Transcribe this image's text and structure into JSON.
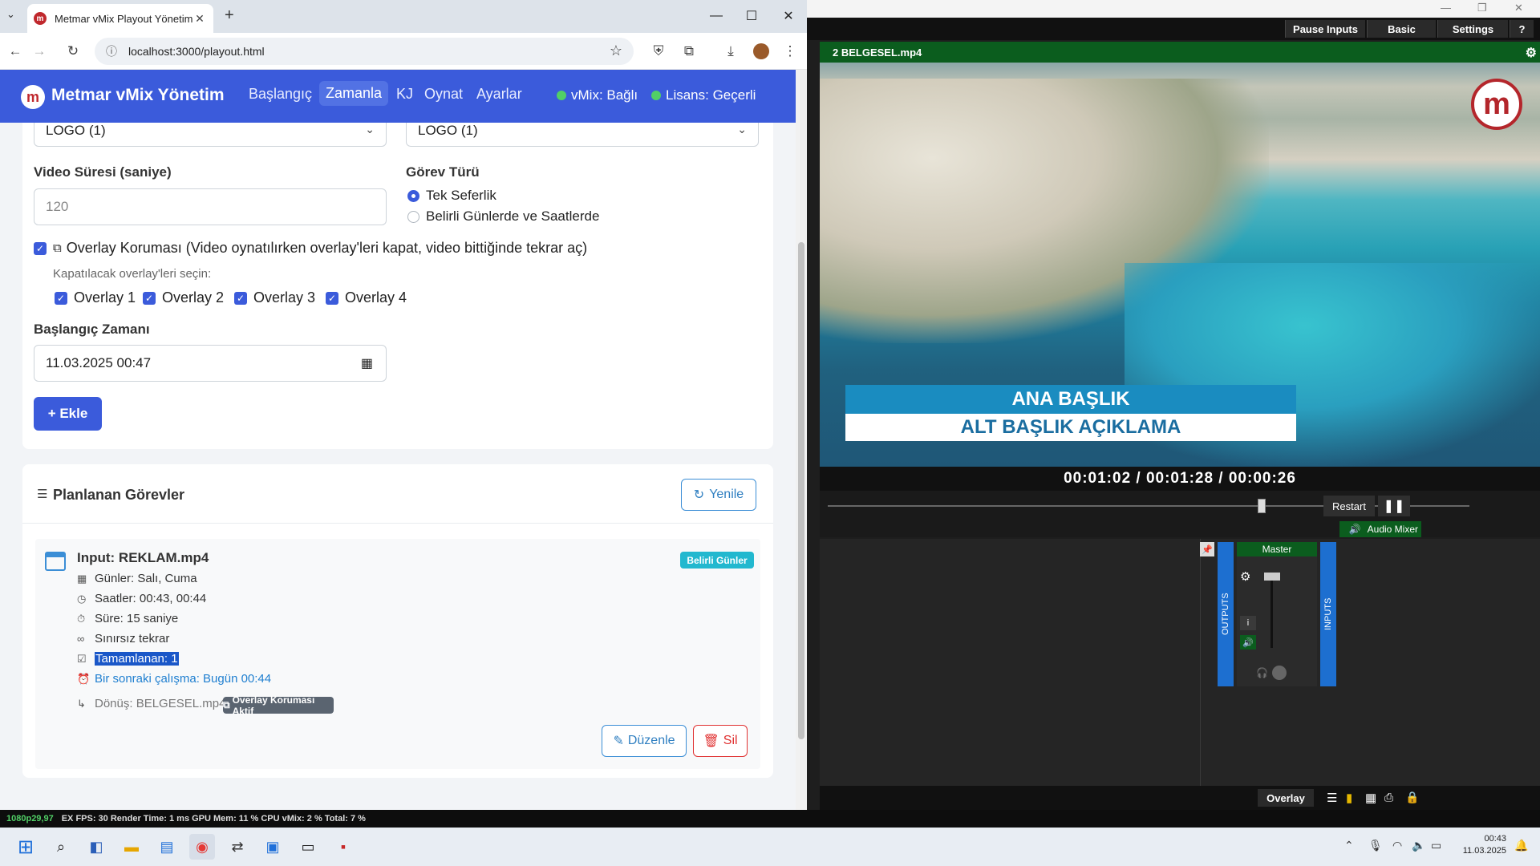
{
  "browser": {
    "tab_title": "Metmar vMix Playout Yönetim S",
    "url": "localhost:3000/playout.html"
  },
  "app": {
    "brand": "Metmar vMix Yönetim",
    "nav": [
      "Başlangıç",
      "Zamanla",
      "KJ",
      "Oynat",
      "Ayarlar"
    ],
    "active_nav": "Zamanla",
    "vmix_status": "vMix: Bağlı",
    "license_status": "Lisans: Geçerli"
  },
  "form": {
    "select_left": "LOGO (1)",
    "select_right": "LOGO (1)",
    "video_duration_label": "Video Süresi (saniye)",
    "video_duration_placeholder": "120",
    "task_type_label": "Görev Türü",
    "task_type_options": [
      "Tek Seferlik",
      "Belirli Günlerde ve Saatlerde"
    ],
    "overlay_protection_label": "Overlay Koruması (Video oynatılırken overlay'leri kapat, video bittiğinde tekrar aç)",
    "overlay_select_hint": "Kapatılacak overlay'leri seçin:",
    "overlays": [
      "Overlay 1",
      "Overlay 2",
      "Overlay 3",
      "Overlay 4"
    ],
    "start_time_label": "Başlangıç Zamanı",
    "start_time_value": "11.03.2025 00:47",
    "add_button": "+ Ekle"
  },
  "tasks": {
    "title": "Planlanan Görevler",
    "refresh_button": "Yenile",
    "items": [
      {
        "input": "Input: REKLAM.mp4",
        "badge": "Belirli Günler",
        "days": "Günler: Salı, Cuma",
        "hours": "Saatler: 00:43, 00:44",
        "duration": "Süre: 15 saniye",
        "repeat": "Sınırsız tekrar",
        "completed": "Tamamlanan: 1",
        "next_run": "Bir sonraki çalışma: Bugün 00:44",
        "return": "Dönüş: BELGESEL.mp4",
        "overlay_badge": "Overlay Koruması Aktif",
        "edit_button": "Düzenle",
        "delete_button": "Sil"
      }
    ]
  },
  "vmix": {
    "top_buttons": [
      "Pause Inputs",
      "Basic",
      "Settings",
      "?"
    ],
    "input_title": "2  BELGESEL.mp4",
    "lower_third_title": "ANA BAŞLIK",
    "lower_third_subtitle": "ALT BAŞLIK AÇIKLAMA",
    "timecode": "00:01:02 / 00:01:28 / 00:00:26",
    "restart_button": "Restart",
    "audio_mixer_label": "Audio Mixer",
    "master_label": "Master",
    "outputs_label": "OUTPUTS",
    "inputs_label": "INPUTS",
    "overlay_button": "Overlay",
    "status_format": "1080p29,97",
    "status_text": "EX  FPS: 30  Render Time: 1 ms  GPU Mem: 11 %  CPU vMix: 2 %  Total: 7 %"
  },
  "taskbar": {
    "time": "00:43",
    "date": "11.03.2025"
  }
}
